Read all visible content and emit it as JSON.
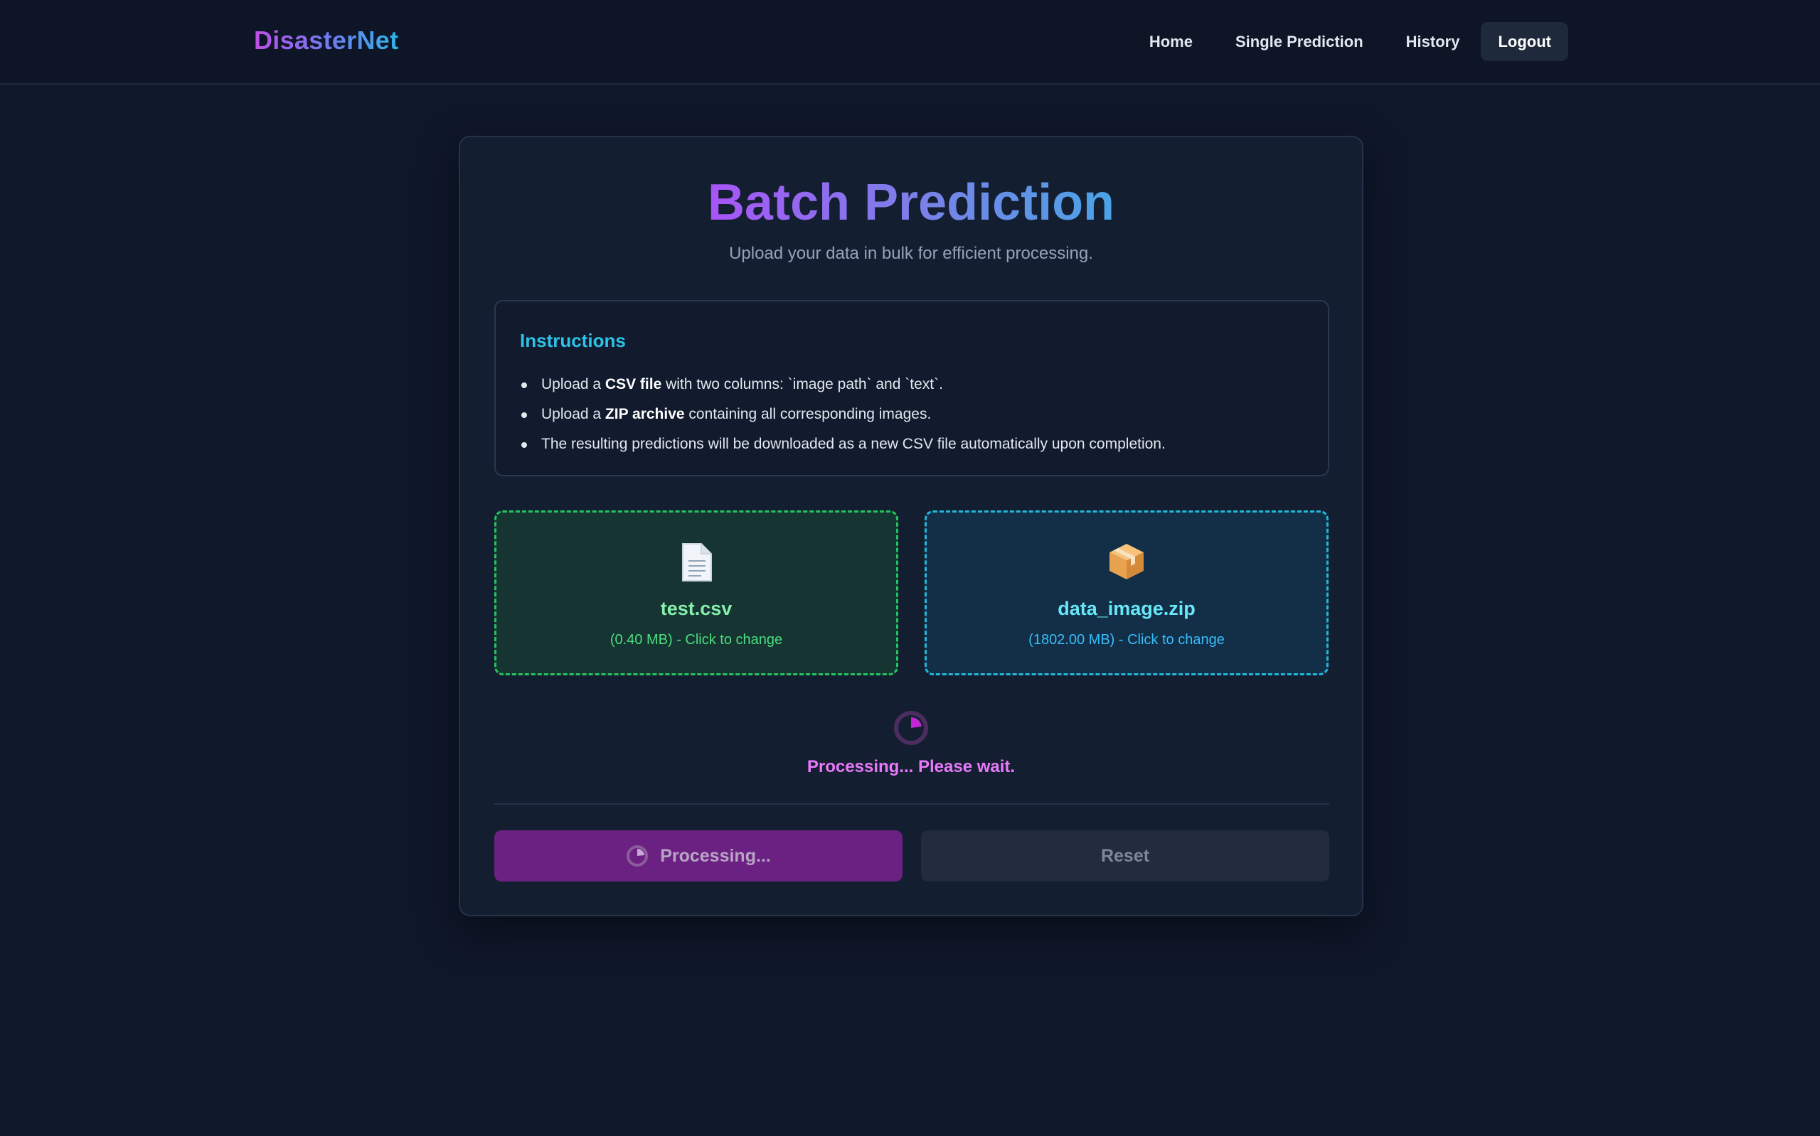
{
  "nav": {
    "brand": "DisasterNet",
    "links": [
      {
        "label": "Home"
      },
      {
        "label": "Single Prediction"
      },
      {
        "label": "History"
      }
    ],
    "logout": "Logout"
  },
  "page": {
    "title": "Batch Prediction",
    "subtitle": "Upload your data in bulk for efficient processing."
  },
  "instructions": {
    "title": "Instructions",
    "items": [
      {
        "pre": "Upload a ",
        "bold": "CSV file",
        "post": " with two columns: `image path` and `text`."
      },
      {
        "pre": "Upload a ",
        "bold": "ZIP archive",
        "post": " containing all corresponding images."
      },
      {
        "pre": "",
        "bold": "",
        "post": "The resulting predictions will be downloaded as a new CSV file automatically upon completion."
      }
    ]
  },
  "uploads": {
    "csv": {
      "icon": "document-icon",
      "name": "test.csv",
      "meta": "(0.40 MB) - Click to change",
      "accent": "#22c55e"
    },
    "zip": {
      "icon": "package-icon",
      "name": "data_image.zip",
      "meta": "(1802.00 MB) - Click to change",
      "accent": "#22b8d8"
    }
  },
  "status": {
    "text": "Processing... Please wait."
  },
  "actions": {
    "process_label": "Processing...",
    "reset_label": "Reset"
  },
  "colors": {
    "background": "#0f172a",
    "card": "#141e31",
    "accent_purple": "#a855f7",
    "accent_cyan": "#2dc2e8"
  }
}
